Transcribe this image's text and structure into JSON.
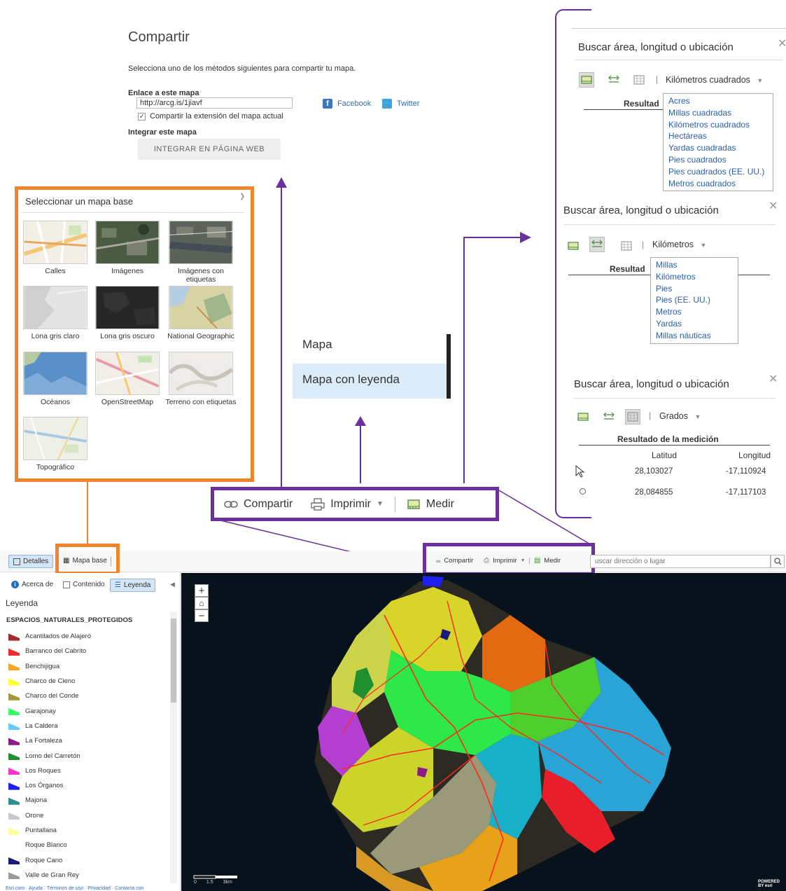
{
  "share": {
    "title": "Compartir",
    "description": "Selecciona uno de los métodos siguientes para compartir tu mapa.",
    "link_label": "Enlace a este mapa",
    "link_value": "http://arcg.is/1jiavf",
    "extent_checkbox_label": "Compartir la extensión del mapa actual",
    "extent_checked": true,
    "facebook_label": "Facebook",
    "twitter_label": "Twitter",
    "embed_label": "Integrar este mapa",
    "embed_button": "INTEGRAR EN PÁGINA WEB"
  },
  "basemap_gallery": {
    "title": "Seleccionar un mapa base",
    "items": [
      {
        "label": "Calles",
        "icon": "streets-thumb"
      },
      {
        "label": "Imágenes",
        "icon": "imagery-thumb"
      },
      {
        "label": "Imágenes con etiquetas",
        "icon": "imagery-labels-thumb"
      },
      {
        "label": "Lona gris claro",
        "icon": "light-gray-thumb"
      },
      {
        "label": "Lona gris oscuro",
        "icon": "dark-gray-thumb"
      },
      {
        "label": "National Geographic",
        "icon": "natgeo-thumb"
      },
      {
        "label": "Océanos",
        "icon": "oceans-thumb"
      },
      {
        "label": "OpenStreetMap",
        "icon": "osm-thumb"
      },
      {
        "label": "Terreno con etiquetas",
        "icon": "terrain-thumb"
      },
      {
        "label": "Topográfico",
        "icon": "topo-thumb"
      }
    ]
  },
  "print_menu": {
    "items": [
      "Mapa",
      "Mapa con leyenda"
    ],
    "selected_index": 1
  },
  "toolbar": {
    "share_label": "Compartir",
    "print_label": "Imprimir",
    "measure_label": "Medir"
  },
  "measure_area": {
    "title": "Buscar área, longitud o ubicación",
    "unit": "Kilómetros cuadrados",
    "result_label": "Resultad",
    "options": [
      "Acres",
      "Millas cuadradas",
      "Kilómetros cuadrados",
      "Hectáreas",
      "Yardas cuadradas",
      "Pies cuadrados",
      "Pies cuadrados (EE. UU.)",
      "Metros cuadrados"
    ]
  },
  "measure_distance": {
    "title": "Buscar área, longitud o ubicación",
    "unit": "Kilómetros",
    "result_label": "Resultad",
    "options": [
      "Millas",
      "Kilómetros",
      "Pies",
      "Pies (EE. UU.)",
      "Metros",
      "Yardas",
      "Millas náuticas"
    ]
  },
  "measure_location": {
    "title": "Buscar área, longitud o ubicación",
    "unit": "Grados",
    "result_label": "Resultado de la medición",
    "col_lat": "Latitud",
    "col_lon": "Longitud",
    "rows": [
      {
        "lat": "28,103027",
        "lon": "-17,110924",
        "icon": "cursor-icon"
      },
      {
        "lat": "28,084855",
        "lon": "-17,117103",
        "icon": "point-icon"
      }
    ]
  },
  "app": {
    "header": {
      "details_label": "Detalles",
      "basemap_label": "Mapa base",
      "share_label": "Compartir",
      "print_label": "Imprimir",
      "measure_label": "Medir",
      "search_placeholder": "uscar dirección o lugar"
    },
    "sidebar": {
      "tabs": [
        {
          "label": "Acerca de",
          "icon": "info-icon"
        },
        {
          "label": "Contenido",
          "icon": "content-icon"
        },
        {
          "label": "Leyenda",
          "icon": "legend-icon"
        }
      ],
      "active_tab": 2,
      "legend_title": "Leyenda",
      "layer_name": "ESPACIOS_NATURALES_PROTEGIDOS",
      "legend_items": [
        {
          "label": "Acantilados de Alajeró",
          "color": "#a52a2a"
        },
        {
          "label": "Barranco del Cabrito",
          "color": "#ee2c2c"
        },
        {
          "label": "Benchijigua",
          "color": "#f5a623"
        },
        {
          "label": "Charco de Cieno",
          "color": "#ffff33"
        },
        {
          "label": "Charco del Conde",
          "color": "#a89a3c"
        },
        {
          "label": "Garajonay",
          "color": "#33ff66"
        },
        {
          "label": "La Caldera",
          "color": "#66ccff"
        },
        {
          "label": "La Fortaleza",
          "color": "#8b1a8b"
        },
        {
          "label": "Lomo del Carretón",
          "color": "#1f8f2f"
        },
        {
          "label": "Los Roques",
          "color": "#ff33cc"
        },
        {
          "label": "Los Órganos",
          "color": "#2020ee"
        },
        {
          "label": "Majona",
          "color": "#2f8f8f"
        },
        {
          "label": "Orone",
          "color": "#c8c8c8"
        },
        {
          "label": "Puntallana",
          "color": "#ffff99"
        },
        {
          "label": "Roque Blanco",
          "color": "#ffffff"
        },
        {
          "label": "Roque Cano",
          "color": "#1a1a7a"
        },
        {
          "label": "Valle de Gran Rey",
          "color": "#999999"
        }
      ],
      "footer": "Esri.com · Ayuda · Términos de uso · Privacidad · Contacta con"
    },
    "map": {
      "scale_labels": [
        "0",
        "1.5",
        "3km"
      ],
      "attribution": "POWERED BY esri"
    }
  },
  "colors": {
    "orange_highlight": "#f0852d",
    "purple_highlight": "#6b2fa0",
    "link_blue": "#2a6ebb"
  }
}
